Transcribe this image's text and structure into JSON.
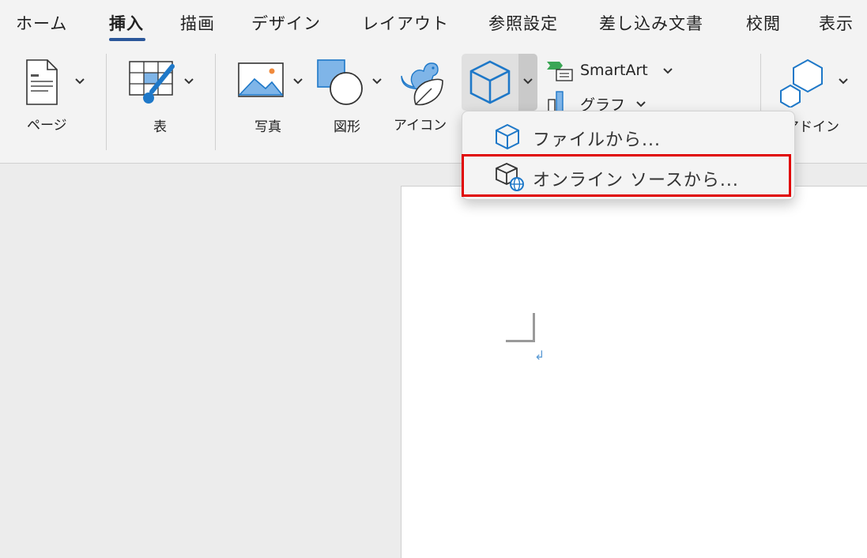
{
  "tabs": [
    {
      "label": "ホーム",
      "active": false
    },
    {
      "label": "挿入",
      "active": true
    },
    {
      "label": "描画",
      "active": false
    },
    {
      "label": "デザイン",
      "active": false
    },
    {
      "label": "レイアウト",
      "active": false
    },
    {
      "label": "参照設定",
      "active": false
    },
    {
      "label": "差し込み文書",
      "active": false
    },
    {
      "label": "校閲",
      "active": false
    },
    {
      "label": "表示",
      "active": false
    }
  ],
  "ribbon": {
    "page_label": "ページ",
    "table_label": "表",
    "photo_label": "写真",
    "shapes_label": "図形",
    "icons_label": "アイコン",
    "smartart_label": "SmartArt",
    "chart_label": "グラフ",
    "addins_label": "アドイン"
  },
  "menu": {
    "items": [
      {
        "label": "ファイルから...",
        "icon": "3d-model-icon"
      },
      {
        "label": "オンライン ソースから...",
        "icon": "3d-model-online-icon",
        "highlighted": true
      }
    ]
  },
  "colors": {
    "accent": "#2b579a",
    "icon_blue": "#1e78c8",
    "highlight": "#e00000"
  }
}
